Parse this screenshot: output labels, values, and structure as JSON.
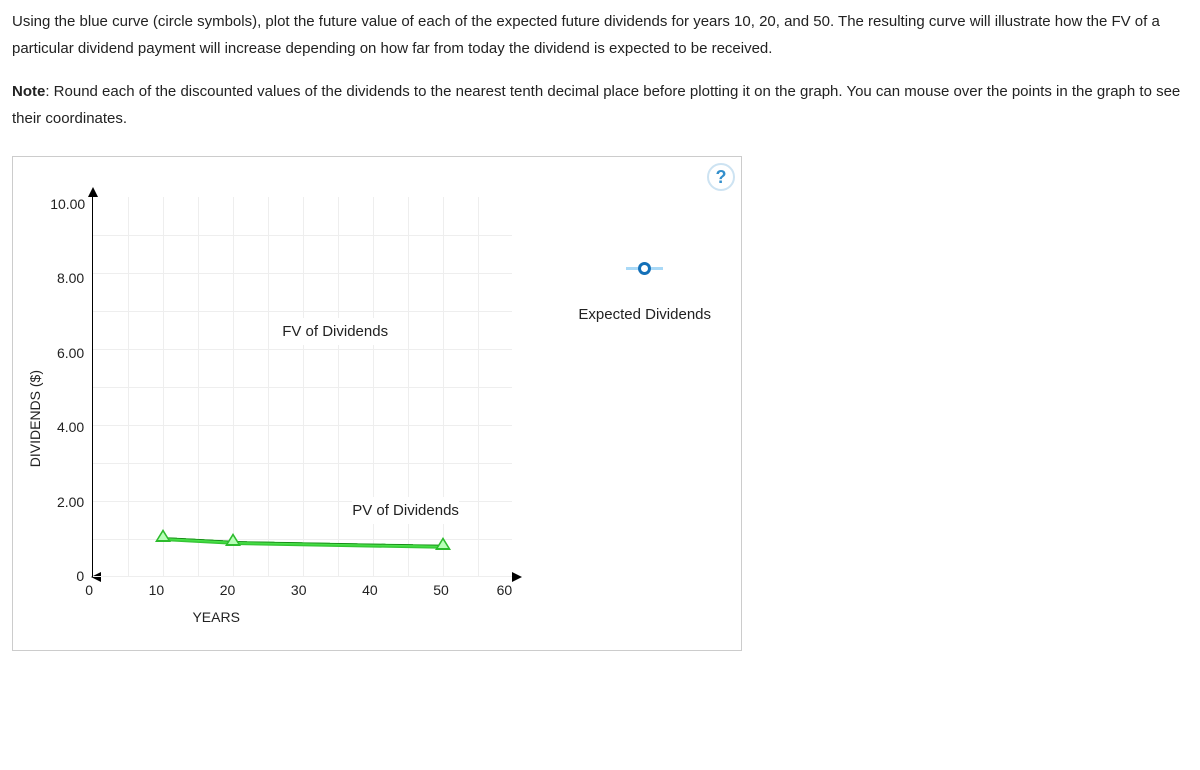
{
  "instructions": {
    "p1": "Using the blue curve (circle symbols), plot the future value of each of the expected future dividends for years 10, 20, and 50. The resulting curve will illustrate how the FV of a particular dividend payment will increase depending on how far from today the dividend is expected to be received.",
    "note_label": "Note",
    "note_text": ": Round each of the discounted values of the dividends to the nearest tenth decimal place before plotting it on the graph. You can mouse over the points in the graph to see their coordinates."
  },
  "help_symbol": "?",
  "legend": {
    "item1": "Expected Dividends",
    "color_dash": "#a9d9f7",
    "color_circle_border": "#1470b8",
    "color_circle_fill": "#ffffff"
  },
  "chart_data": {
    "type": "line",
    "title": "",
    "xlabel": "YEARS",
    "ylabel": "DIVIDENDS ($)",
    "xlim": [
      0,
      60
    ],
    "ylim": [
      0,
      10
    ],
    "x_ticks": [
      "0",
      "10",
      "20",
      "30",
      "40",
      "50",
      "60"
    ],
    "y_ticks": [
      "10.00",
      "8.00",
      "6.00",
      "4.00",
      "2.00",
      "0"
    ],
    "series": [
      {
        "name": "PV of Dividends",
        "marker": "triangle",
        "color": "#2dbb2d",
        "x": [
          10,
          20,
          50
        ],
        "values": [
          1.0,
          0.9,
          0.8
        ]
      },
      {
        "name": "FV of Dividends",
        "marker": "circle",
        "color": "#1470b8",
        "x": [],
        "values": []
      }
    ],
    "annotations": [
      {
        "text": "FV of Dividends",
        "x": 27,
        "y": 6.6
      },
      {
        "text": "PV of Dividends",
        "x": 37,
        "y": 1.9
      }
    ]
  }
}
